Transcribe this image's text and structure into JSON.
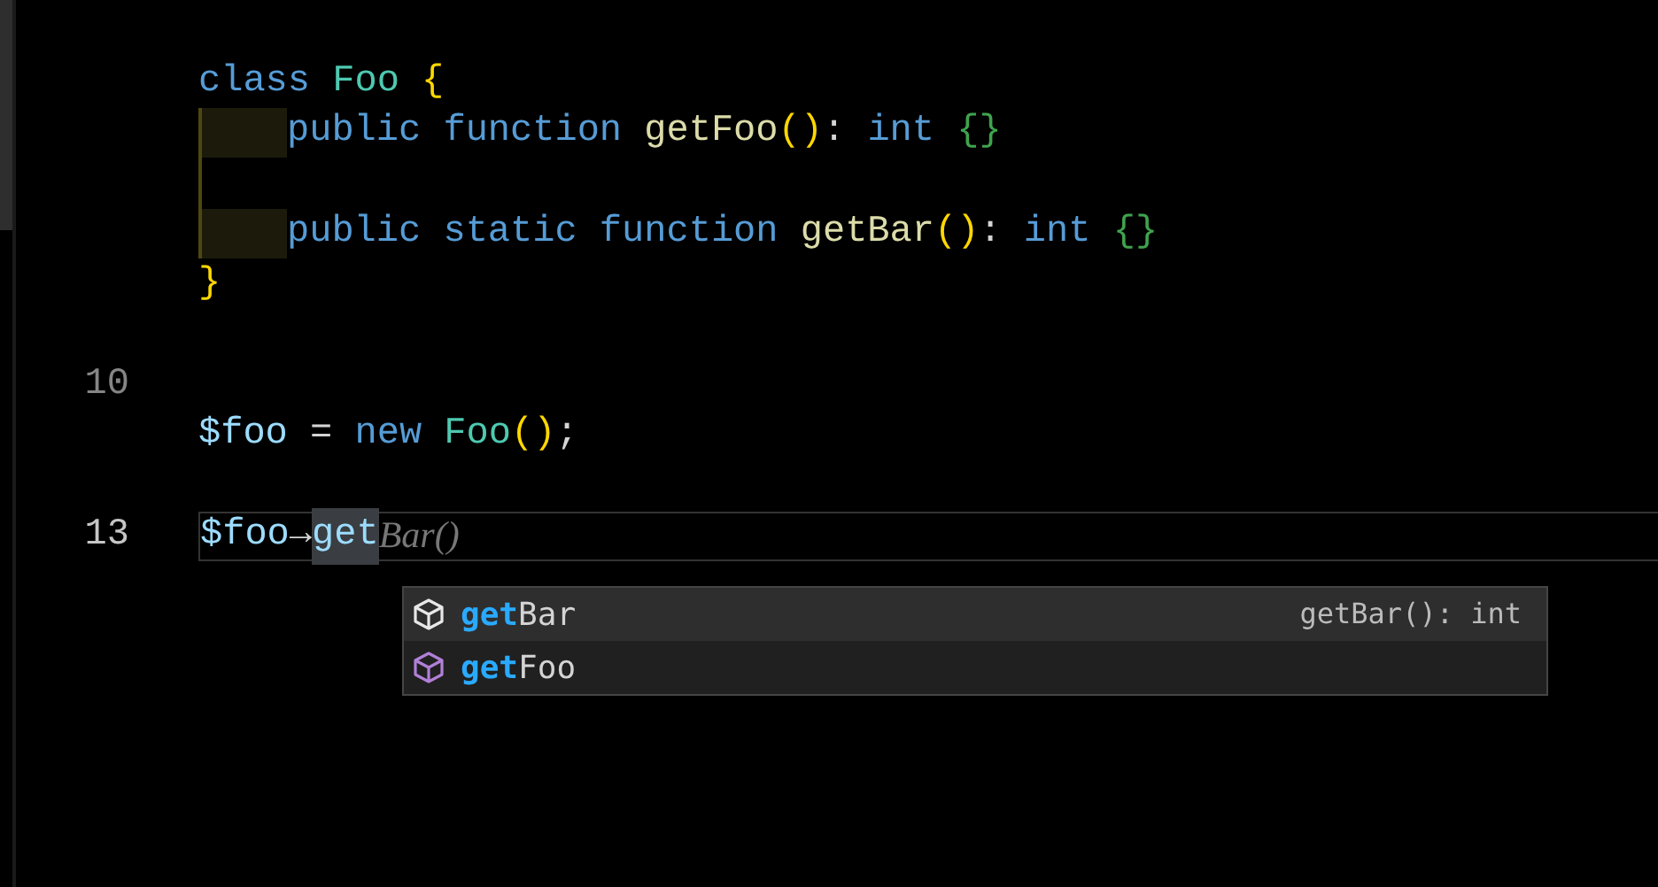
{
  "editor": {
    "lines": [
      {
        "tokens": [
          {
            "text": "class ",
            "kind": "keyword"
          },
          {
            "text": "Foo ",
            "kind": "class"
          },
          {
            "text": "{",
            "kind": "brace"
          }
        ]
      },
      {
        "guide": true,
        "indented": true,
        "tokens": [
          {
            "text": "public function ",
            "kind": "keyword"
          },
          {
            "text": "getFoo",
            "kind": "func"
          },
          {
            "text": "()",
            "kind": "brace"
          },
          {
            "text": ": ",
            "kind": "plain"
          },
          {
            "text": "int ",
            "kind": "keyword"
          },
          {
            "text": "{}",
            "kind": "brace2"
          }
        ]
      },
      {
        "guide": true
      },
      {
        "guide": true,
        "indented": true,
        "tokens": [
          {
            "text": "public static function ",
            "kind": "keyword"
          },
          {
            "text": "getBar",
            "kind": "func"
          },
          {
            "text": "()",
            "kind": "brace"
          },
          {
            "text": ": ",
            "kind": "plain"
          },
          {
            "text": "int ",
            "kind": "keyword"
          },
          {
            "text": "{}",
            "kind": "brace2"
          }
        ]
      },
      {
        "tokens": [
          {
            "text": "}",
            "kind": "brace"
          }
        ]
      },
      {
        "gap_before": true,
        "number": "10"
      },
      {
        "tokens": [
          {
            "text": "$foo",
            "kind": "var"
          },
          {
            "text": " = ",
            "kind": "plain"
          },
          {
            "text": "new ",
            "kind": "keyword"
          },
          {
            "text": "Foo",
            "kind": "class"
          },
          {
            "text": "()",
            "kind": "brace"
          },
          {
            "text": ";",
            "kind": "plain"
          }
        ]
      },
      {
        "gap_before": true,
        "number": "13",
        "current": true,
        "tokens": [
          {
            "text": "$foo",
            "kind": "var"
          },
          {
            "text": "→",
            "kind": "plain"
          },
          {
            "text": "get",
            "kind": "typed"
          },
          {
            "text": "Bar()",
            "kind": "ghost"
          }
        ]
      }
    ]
  },
  "suggestions": [
    {
      "match": "get",
      "rest": "Bar",
      "detail": "getBar(): int",
      "selected": true
    },
    {
      "match": "get",
      "rest": "Foo",
      "selected": false
    }
  ]
}
